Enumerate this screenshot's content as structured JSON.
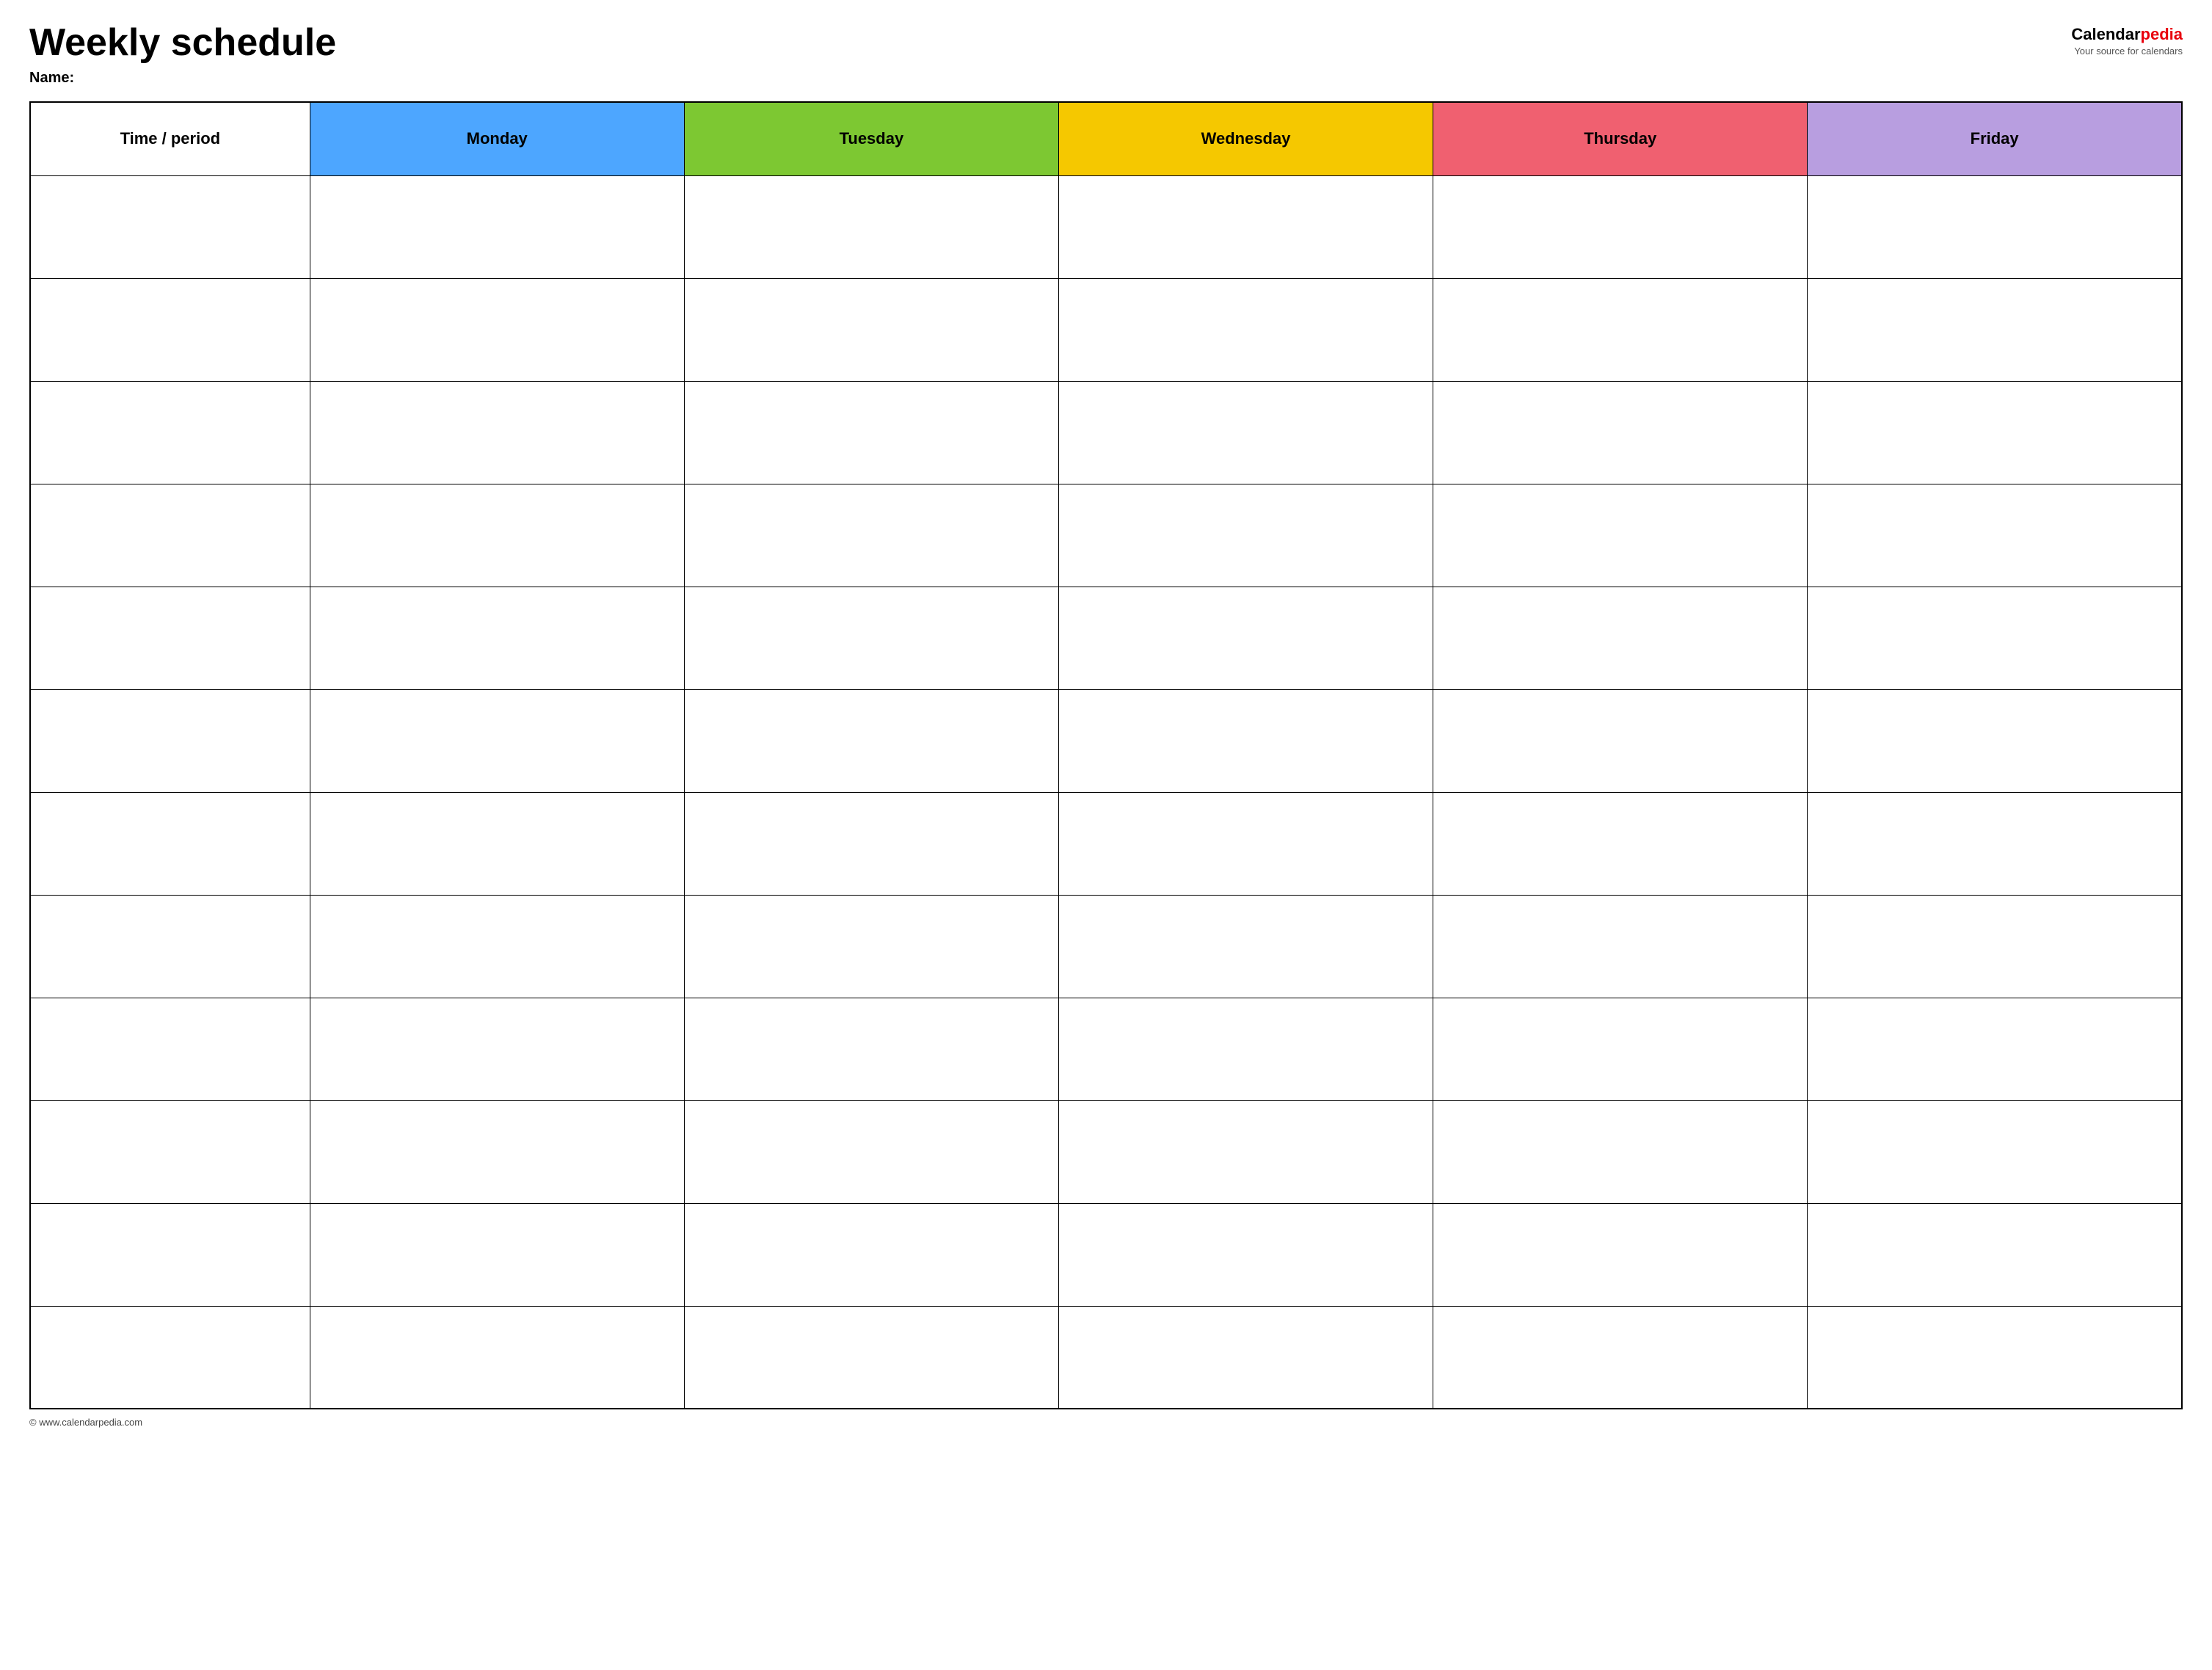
{
  "header": {
    "title": "Weekly schedule",
    "name_label": "Name:",
    "logo": {
      "text_black": "Calendar",
      "text_red": "pedia",
      "subtitle": "Your source for calendars"
    }
  },
  "table": {
    "columns": [
      {
        "key": "time",
        "label": "Time / period",
        "color": "#ffffff"
      },
      {
        "key": "monday",
        "label": "Monday",
        "color": "#4da6ff"
      },
      {
        "key": "tuesday",
        "label": "Tuesday",
        "color": "#7dc832"
      },
      {
        "key": "wednesday",
        "label": "Wednesday",
        "color": "#f5c800"
      },
      {
        "key": "thursday",
        "label": "Thursday",
        "color": "#f06070"
      },
      {
        "key": "friday",
        "label": "Friday",
        "color": "#b89ee0"
      }
    ],
    "row_count": 12
  },
  "footer": {
    "text": "© www.calendarpedia.com"
  }
}
